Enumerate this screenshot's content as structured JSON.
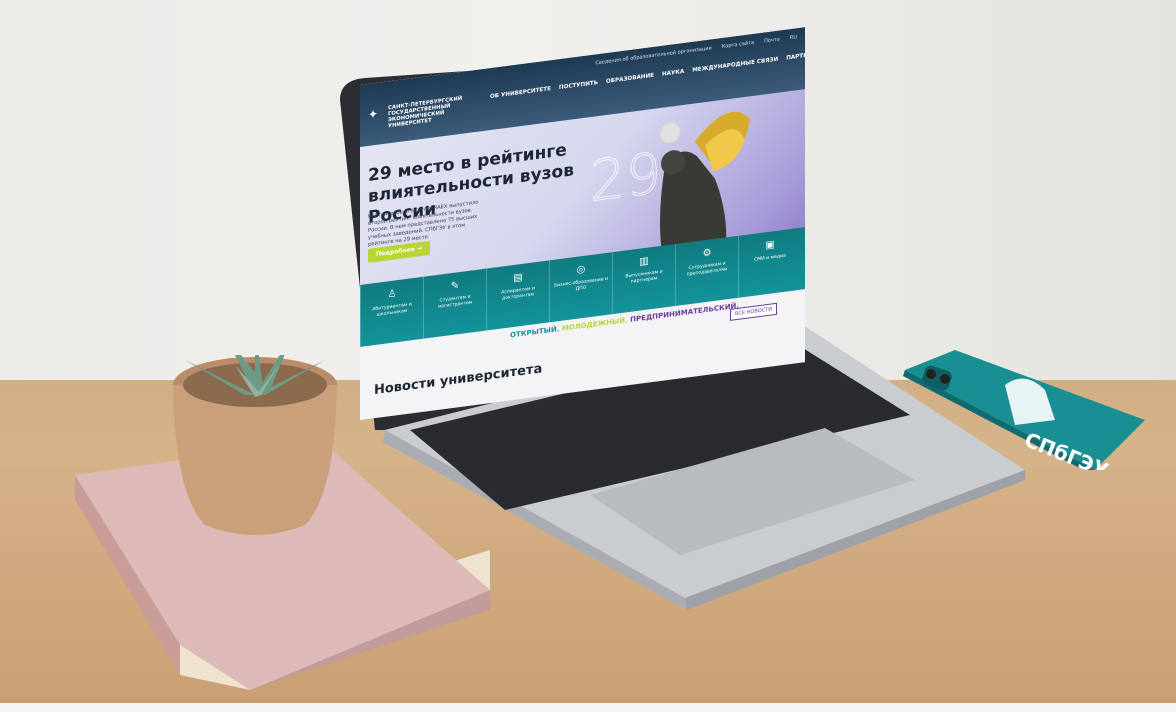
{
  "site": {
    "util_links": [
      "Сведения об образовательной организации",
      "Карта сайта",
      "Почта",
      "RU"
    ],
    "logo_lines": [
      "САНКТ-ПЕТЕРБУРГСКИЙ",
      "ГОСУДАРСТВЕННЫЙ",
      "ЭКОНОМИЧЕСКИЙ УНИВЕРСИТЕТ"
    ],
    "nav": [
      "ОБ УНИВЕРСИТЕТЕ",
      "ПОСТУПИТЬ",
      "ОБРАЗОВАНИЕ",
      "НАУКА",
      "МЕЖДУНАРОДНЫЕ СВЯЗИ",
      "ПАРТНЕРСТВО"
    ],
    "hero": {
      "title": "29 место в рейтинге влиятельности вузов России",
      "text": "Рейтинговое агентство RAEX выпустило второй рейтинг влиятельности вузов России. В нем представлено 75 высших учебных заведений. СПбГЭУ в этом рейтинге на 29 месте.",
      "button": "Подробнее →",
      "number": "29"
    },
    "audiences": [
      {
        "label": "Абитуриентам и школьникам",
        "icon": "graduation-bell-icon"
      },
      {
        "label": "Студентам и магистрантам",
        "icon": "pencil-icon"
      },
      {
        "label": "Аспирантам и докторантам",
        "icon": "book-icon"
      },
      {
        "label": "Бизнес-образование и ДПО",
        "icon": "target-icon"
      },
      {
        "label": "Выпускникам и партнерам",
        "icon": "chart-icon"
      },
      {
        "label": "Сотрудникам и преподавателям",
        "icon": "gear-icon"
      },
      {
        "label": "СМИ и медиа",
        "icon": "media-icon"
      }
    ],
    "slogan": [
      "ОТКРЫТЫЙ.",
      "МОЛОДЕЖНЫЙ.",
      "ПРЕДПРИНИМАТЕЛЬСКИЙ."
    ],
    "all_news": "ВСЕ НОВОСТИ",
    "news_heading": "Новости университета"
  },
  "phone_case": {
    "text": "СПбГЭУ"
  },
  "colors": {
    "teal": "#13939a",
    "lime": "#b8d533",
    "purple": "#6b3a98",
    "header": "#1e3a52"
  }
}
